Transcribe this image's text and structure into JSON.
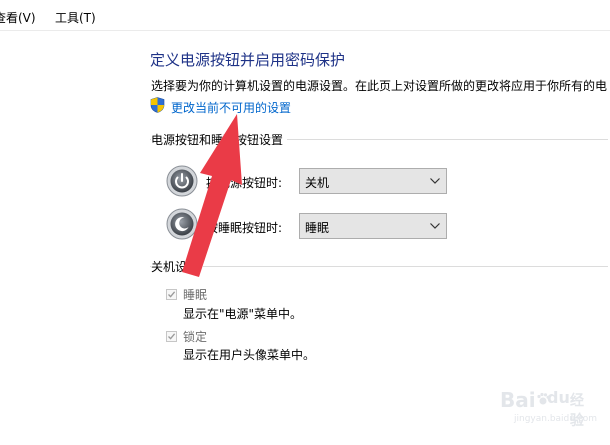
{
  "menu": [
    {
      "label": "查看(V)"
    },
    {
      "label": "工具(T)"
    }
  ],
  "page": {
    "title": "定义电源按钮并启用密码保护",
    "intro": "选择要为你的计算机设置的电源设置。在此页上对设置所做的更改将应用于你所有的电",
    "admin_link": "更改当前不可用的设置"
  },
  "power_section": {
    "title": "电源按钮和睡眠按钮设置",
    "rows": [
      {
        "label": "按电源按钮时:",
        "value": "关机",
        "icon": "power-button-icon"
      },
      {
        "label": "按睡眠按钮时:",
        "value": "睡眠",
        "icon": "sleep-button-icon"
      }
    ]
  },
  "shutdown_section": {
    "title": "关机设置",
    "items": [
      {
        "label": "睡眠",
        "desc": "显示在\"电源\"菜单中。",
        "checked": true
      },
      {
        "label": "锁定",
        "desc": "显示在用户头像菜单中。",
        "checked": true
      }
    ]
  },
  "watermark": {
    "logo": "Bai",
    "paw": "du",
    "text": "经验",
    "url": "jingyan.baidu.com"
  },
  "colors": {
    "title": "#1e3287",
    "link": "#0066cc",
    "arrow": "#ea3b47",
    "dropdown_bg": "#e5e5e5",
    "disabled_text": "#6d6d6d"
  }
}
